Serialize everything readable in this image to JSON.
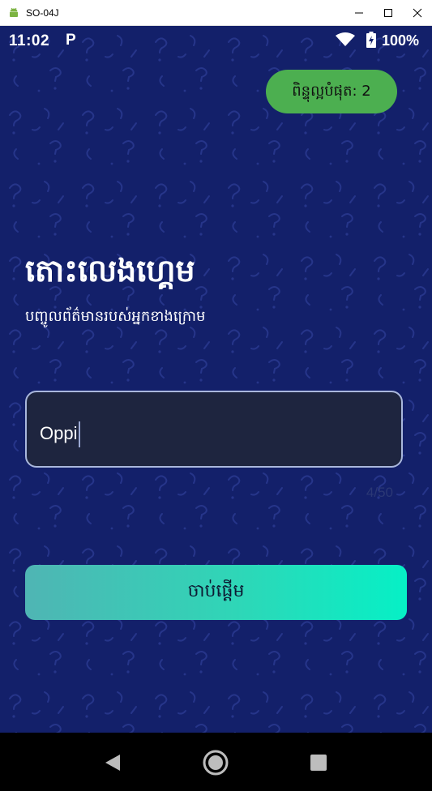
{
  "window": {
    "title": "SO-04J",
    "icon": "android-icon",
    "controls": [
      "minimize-icon",
      "maximize-icon",
      "close-icon"
    ]
  },
  "status_bar": {
    "time": "11:02",
    "notification_icon": "P",
    "battery": "100%"
  },
  "game": {
    "best_score_label": "ពិន្ទុល្អបំផុត: 2",
    "title": "តោះលេងហ្គេម",
    "subtitle": "បញ្ចូលព័ត៌មានរបស់អ្នកខាងក្រោម",
    "name_input": {
      "value": "Oppi",
      "placeholder": ""
    },
    "char_counter": "4/50",
    "start_button_label": "ចាប់ផ្ដើម"
  },
  "colors": {
    "background": "#13206a",
    "pill": "#4caf50",
    "button_gradient": [
      "#4fb5b4",
      "#06f0c6"
    ],
    "field_border": "#a9b7dc"
  },
  "nav_bar": [
    "back-icon",
    "home-icon",
    "recents-icon"
  ]
}
